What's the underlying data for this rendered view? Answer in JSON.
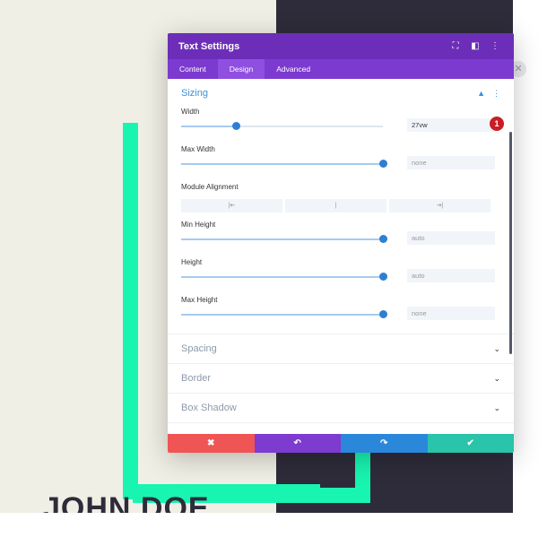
{
  "background": {
    "name_text": "JOHN DOE",
    "accent_color": "#18f5b1",
    "dark_color": "#2e2c3a",
    "cream_color": "#f0efe5"
  },
  "edge_button_icon": "close-icon",
  "modal": {
    "title": "Text Settings",
    "header_icons": [
      "expand-icon",
      "split-view-icon",
      "more-options-icon"
    ],
    "tabs": [
      {
        "label": "Content",
        "active": false
      },
      {
        "label": "Design",
        "active": true
      },
      {
        "label": "Advanced",
        "active": false
      }
    ],
    "sizing": {
      "title": "Sizing",
      "fields": {
        "width": {
          "label": "Width",
          "value": "27vw",
          "slider": 0.27
        },
        "max_width": {
          "label": "Max Width",
          "placeholder": "none",
          "slider": 1.0
        },
        "module_alignment": {
          "label": "Module Alignment",
          "options": [
            "|⇤",
            "|",
            "⇥|"
          ]
        },
        "min_height": {
          "label": "Min Height",
          "placeholder": "auto",
          "slider": 1.0
        },
        "height": {
          "label": "Height",
          "placeholder": "auto",
          "slider": 1.0
        },
        "max_height": {
          "label": "Max Height",
          "placeholder": "none",
          "slider": 1.0
        }
      },
      "badge": "1"
    },
    "sections": [
      {
        "title": "Spacing"
      },
      {
        "title": "Border"
      },
      {
        "title": "Box Shadow"
      }
    ],
    "footer": [
      {
        "icon": "cancel-icon",
        "glyph": "✖",
        "color": "#ef5555"
      },
      {
        "icon": "undo-icon",
        "glyph": "↶",
        "color": "#7e3bd0"
      },
      {
        "icon": "redo-icon",
        "glyph": "↷",
        "color": "#2b87da"
      },
      {
        "icon": "save-icon",
        "glyph": "✔",
        "color": "#29c4a9"
      }
    ]
  }
}
